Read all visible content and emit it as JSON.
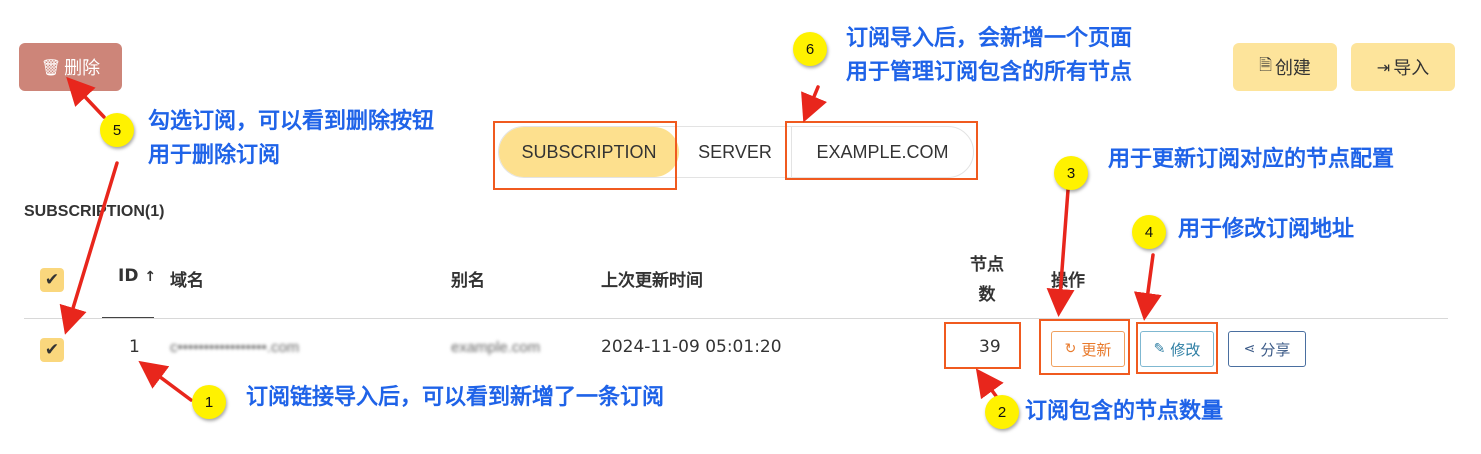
{
  "toolbar": {
    "delete_label": "删除",
    "create_label": "创建",
    "import_label": "导入"
  },
  "tabs": [
    {
      "label": "SUBSCRIPTION",
      "active": true
    },
    {
      "label": "SERVER",
      "active": false
    },
    {
      "label": "EXAMPLE.COM",
      "active": false
    }
  ],
  "section_title": "SUBSCRIPTION(1)",
  "table": {
    "headers": {
      "id": "ID",
      "sort_icon": "↑",
      "domain": "域名",
      "alias": "别名",
      "last_update": "上次更新时间",
      "node_count_line1": "节点",
      "node_count_line2": "数",
      "actions": "操作"
    },
    "rows": [
      {
        "checked": true,
        "id": "1",
        "domain": "c•••••••••••••••••.com",
        "alias": "example.com",
        "last_update": "2024-11-09 05:01:20",
        "node_count": "39",
        "actions": {
          "update": "更新",
          "edit": "修改",
          "share": "分享"
        }
      }
    ]
  },
  "annotations": {
    "n1": {
      "marker": "1",
      "text": "订阅链接导入后，可以看到新增了一条订阅"
    },
    "n2": {
      "marker": "2",
      "text": "订阅包含的节点数量"
    },
    "n3": {
      "marker": "3",
      "text": "用于更新订阅对应的节点配置"
    },
    "n4": {
      "marker": "4",
      "text": "用于修改订阅地址"
    },
    "n5": {
      "marker": "5",
      "line1": "勾选订阅，可以看到删除按钮",
      "line2": "用于删除订阅"
    },
    "n6": {
      "marker": "6",
      "line1": "订阅导入后，会新增一个页面",
      "line2": "用于管理订阅包含的所有节点"
    }
  },
  "colors": {
    "annotation_text": "#1f63e8",
    "highlight_box": "#f05a1f",
    "arrow": "#e8261c",
    "marker_fill": "#fff200",
    "primary_button": "#fde49b",
    "delete_button": "#cd8579",
    "active_tab": "#fde08e"
  },
  "icons": {
    "delete": "trash-icon",
    "create": "file-plus-icon",
    "import": "import-icon",
    "update": "refresh-icon",
    "edit": "edit-icon",
    "share": "share-icon",
    "check": "check-icon"
  }
}
